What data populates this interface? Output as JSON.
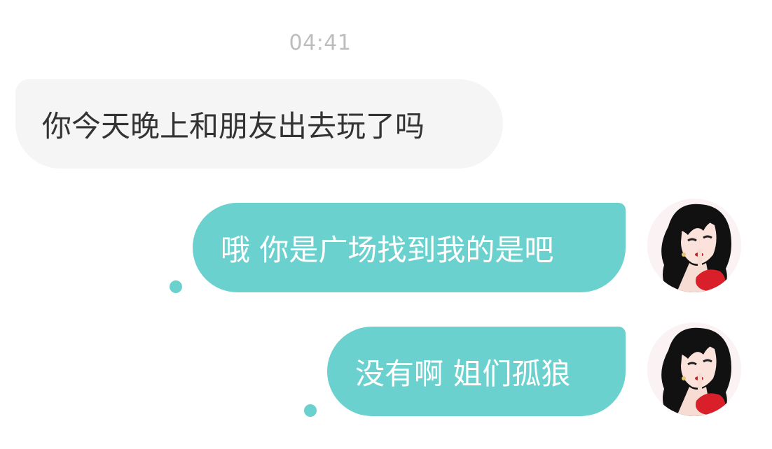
{
  "chat": {
    "timestamp": "04:41",
    "messages": [
      {
        "side": "received",
        "text": "你今天晚上和朋友出去玩了吗"
      },
      {
        "side": "sent",
        "text": "哦 你是广场找到我的是吧"
      },
      {
        "side": "sent",
        "text": "没有啊 姐们孤狼"
      }
    ],
    "avatar_icon": "user-avatar-illustrated-woman"
  },
  "colors": {
    "sent_bubble": "#6bd1cf",
    "received_bubble": "#f5f5f5",
    "timestamp_text": "#bdbdbd"
  }
}
